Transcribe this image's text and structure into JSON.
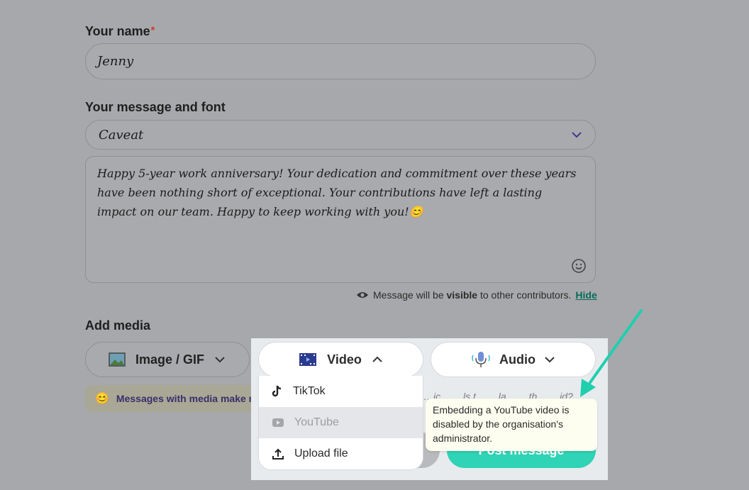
{
  "form": {
    "name_label": "Your name",
    "required_mark": "*",
    "name_value": "Jenny",
    "message_label": "Your message and font",
    "font_selected": "Caveat",
    "message_text": "Happy 5-year work anniversary! Your dedication and commitment over these years have been nothing short of exceptional. Your contributions have left a lasting impact on our team. Happy to keep working with you!😊",
    "visibility_prefix": "Message will be ",
    "visibility_bold": "visible",
    "visibility_suffix": " to other contributors.",
    "hide_link": "Hide"
  },
  "media": {
    "label": "Add media",
    "image_gif_label": "Image / GIF",
    "video_label": "Video",
    "audio_label": "Audio",
    "banner_text": "Messages with media make rec",
    "video_menu": [
      {
        "label": "TikTok",
        "icon": "tiktok-icon"
      },
      {
        "label": "YouTube",
        "icon": "youtube-icon",
        "disabled": true
      },
      {
        "label": "Upload file",
        "icon": "upload-icon"
      }
    ],
    "partial_hidden_text": "…ic… …ls t… …la… …th… …id?",
    "tooltip": "Embedding a YouTube video is disabled by the organisation's administrator."
  },
  "actions": {
    "post_label": "Post message"
  },
  "colors": {
    "accent": "#2fd3b5",
    "arrow": "#1fcfae",
    "link": "#0a6b5a",
    "required": "#d93025"
  }
}
